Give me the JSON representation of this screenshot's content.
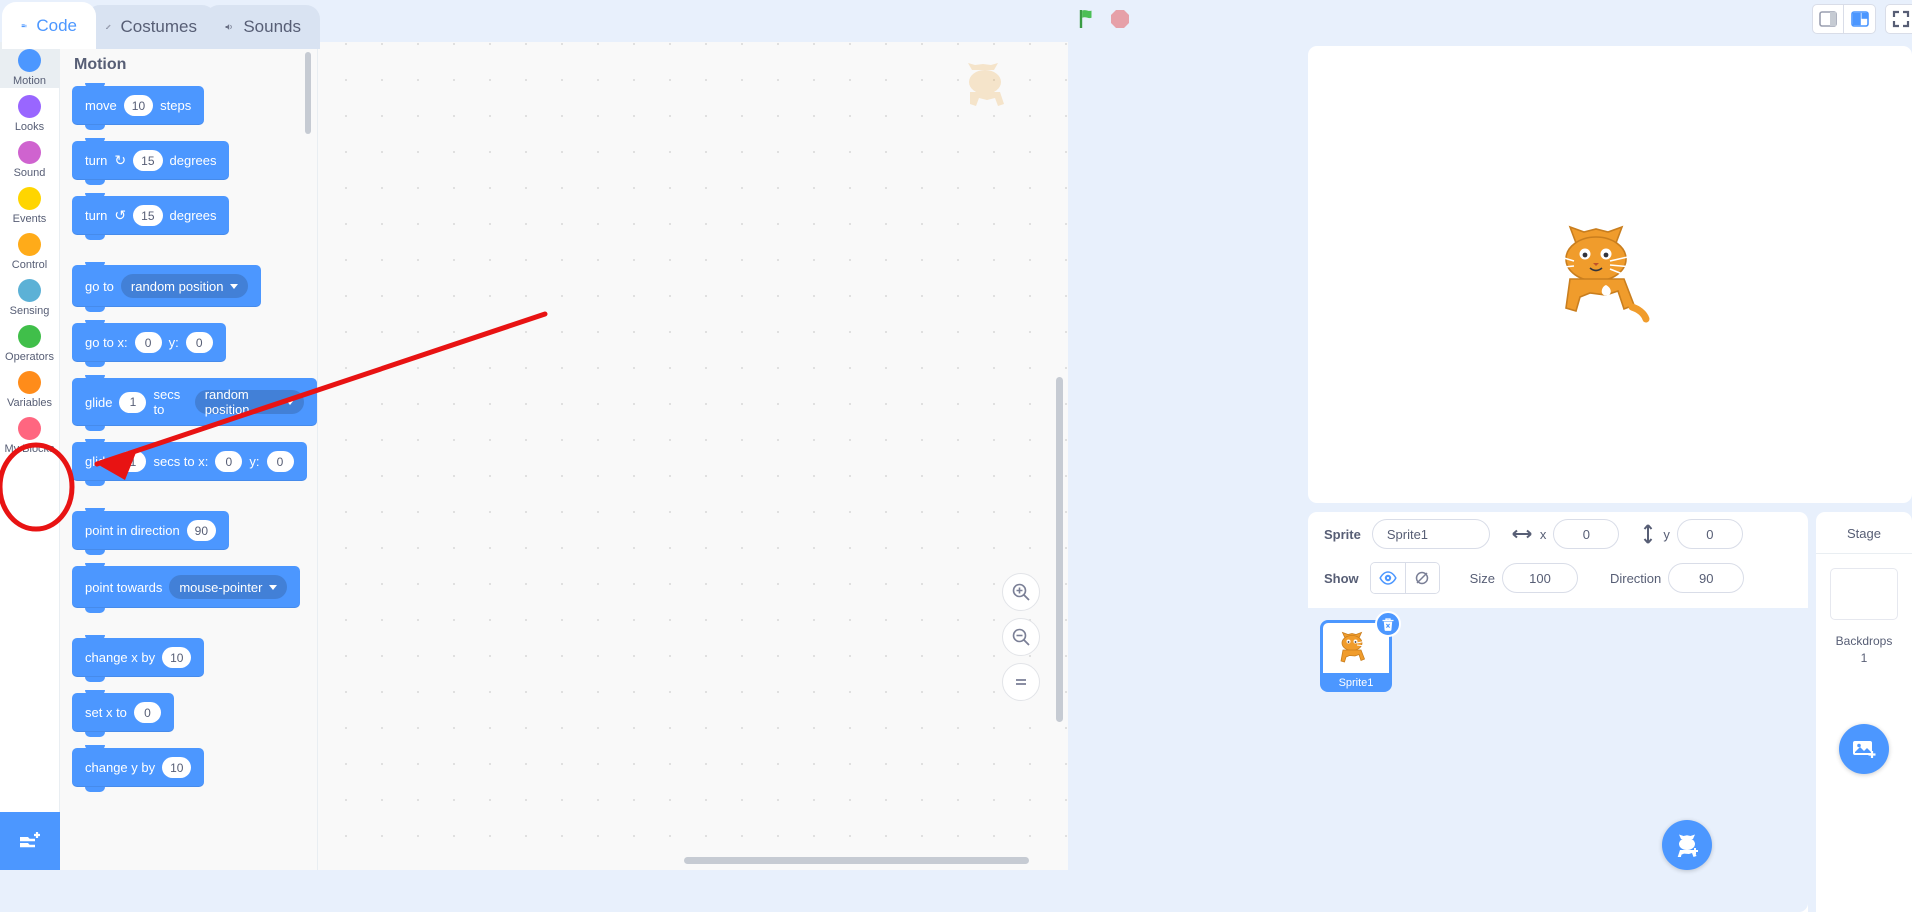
{
  "tabs": [
    {
      "label": "Code",
      "icon": "code-icon",
      "active": true
    },
    {
      "label": "Costumes",
      "icon": "brush-icon",
      "active": false
    },
    {
      "label": "Sounds",
      "icon": "speaker-icon",
      "active": false
    }
  ],
  "controls": {
    "green_flag": "green-flag-icon",
    "stop": "stop-icon",
    "small_stage": "small-stage-icon",
    "large_stage": "large-stage-icon",
    "fullscreen": "fullscreen-icon"
  },
  "categories": [
    {
      "label": "Motion",
      "color": "#4c97ff",
      "selected": true
    },
    {
      "label": "Looks",
      "color": "#9966ff",
      "selected": false
    },
    {
      "label": "Sound",
      "color": "#cf63cf",
      "selected": false
    },
    {
      "label": "Events",
      "color": "#ffd500",
      "selected": false
    },
    {
      "label": "Control",
      "color": "#ffab19",
      "selected": false
    },
    {
      "label": "Sensing",
      "color": "#5cb1d6",
      "selected": false
    },
    {
      "label": "Operators",
      "color": "#40bf4a",
      "selected": false
    },
    {
      "label": "Variables",
      "color": "#ff8c1a",
      "selected": false,
      "annotated": true
    },
    {
      "label": "My Blocks",
      "color": "#ff6680",
      "selected": false
    }
  ],
  "palette": {
    "heading": "Motion",
    "blocks": [
      {
        "id": "move-steps",
        "parts": [
          {
            "t": "text",
            "v": "move"
          },
          {
            "t": "input",
            "v": "10"
          },
          {
            "t": "text",
            "v": "steps"
          }
        ]
      },
      {
        "id": "turn-right",
        "parts": [
          {
            "t": "text",
            "v": "turn"
          },
          {
            "t": "rot",
            "v": "↻"
          },
          {
            "t": "input",
            "v": "15"
          },
          {
            "t": "text",
            "v": "degrees"
          }
        ]
      },
      {
        "id": "turn-left",
        "parts": [
          {
            "t": "text",
            "v": "turn"
          },
          {
            "t": "rot",
            "v": "↺"
          },
          {
            "t": "input",
            "v": "15"
          },
          {
            "t": "text",
            "v": "degrees"
          }
        ],
        "gap": true
      },
      {
        "id": "go-to",
        "parts": [
          {
            "t": "text",
            "v": "go to"
          },
          {
            "t": "dropdown",
            "v": "random position"
          }
        ]
      },
      {
        "id": "go-to-xy",
        "parts": [
          {
            "t": "text",
            "v": "go to x:"
          },
          {
            "t": "input",
            "v": "0"
          },
          {
            "t": "text",
            "v": "y:"
          },
          {
            "t": "input",
            "v": "0"
          }
        ]
      },
      {
        "id": "glide-to",
        "parts": [
          {
            "t": "text",
            "v": "glide"
          },
          {
            "t": "input",
            "v": "1"
          },
          {
            "t": "text",
            "v": "secs to"
          },
          {
            "t": "dropdown",
            "v": "random position"
          }
        ]
      },
      {
        "id": "glide-to-xy",
        "parts": [
          {
            "t": "text",
            "v": "glide"
          },
          {
            "t": "input",
            "v": "1"
          },
          {
            "t": "text",
            "v": "secs to x:"
          },
          {
            "t": "input",
            "v": "0"
          },
          {
            "t": "text",
            "v": "y:"
          },
          {
            "t": "input",
            "v": "0"
          }
        ],
        "gap": true
      },
      {
        "id": "point-in-direction",
        "parts": [
          {
            "t": "text",
            "v": "point in direction"
          },
          {
            "t": "input",
            "v": "90"
          }
        ]
      },
      {
        "id": "point-towards",
        "parts": [
          {
            "t": "text",
            "v": "point towards"
          },
          {
            "t": "dropdown",
            "v": "mouse-pointer"
          }
        ],
        "gap": true
      },
      {
        "id": "change-x-by",
        "parts": [
          {
            "t": "text",
            "v": "change x by"
          },
          {
            "t": "input",
            "v": "10"
          }
        ]
      },
      {
        "id": "set-x-to",
        "parts": [
          {
            "t": "text",
            "v": "set x to"
          },
          {
            "t": "input",
            "v": "0"
          }
        ]
      },
      {
        "id": "change-y-by",
        "parts": [
          {
            "t": "text",
            "v": "change y by"
          },
          {
            "t": "input",
            "v": "10"
          }
        ]
      }
    ]
  },
  "code_area": {
    "zoom_in": "zoom-in-icon",
    "zoom_out": "zoom-out-icon",
    "zoom_reset": "zoom-reset-icon"
  },
  "sprite_info": {
    "sprite_label": "Sprite",
    "sprite_name": "Sprite1",
    "x_label": "x",
    "x_value": "0",
    "y_label": "y",
    "y_value": "0",
    "show_label": "Show",
    "size_label": "Size",
    "size_value": "100",
    "direction_label": "Direction",
    "direction_value": "90"
  },
  "sprite_list": [
    {
      "name": "Sprite1",
      "selected": true
    }
  ],
  "stage_panel": {
    "title": "Stage",
    "subtitle": "Backdrops",
    "count": "1"
  },
  "annotation": {
    "type": "arrow-and-circle",
    "color": "#e81313",
    "target": "Variables"
  }
}
